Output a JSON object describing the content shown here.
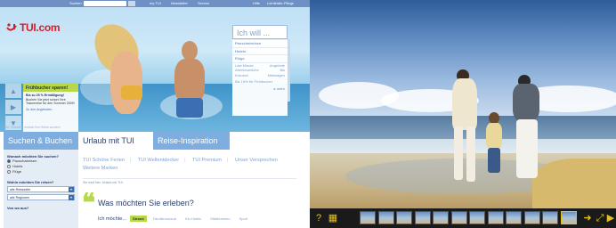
{
  "tui": {
    "topbar": {
      "search_label": "Suchen",
      "links": [
        "my TUI",
        "Newsletter",
        "Service"
      ],
      "user_link": "Hilfe",
      "user_link2": "Leinfelder-Pliege"
    },
    "logo_text": "TUI.com",
    "slide": {
      "headline": "Frühbucher sparen!",
      "discount": "Bis zu 25 % Ermäßigung!",
      "body": "Buchen Sie jetzt schon! Ihre Traumreise für den Sommer 2009!",
      "link": "Zu den Angeboten"
    },
    "hinweis": "Hier: Schnell & einfach Ihre Reise suchen!",
    "ichwill": {
      "title": "Ich will ...",
      "items": [
        "Pauschalreisen",
        "Hotels",
        "Flüge"
      ],
      "pairs": [
        [
          "Last Minute",
          "Angebote"
        ],
        [
          "Abenteuerliche",
          "Bis"
        ],
        [
          "Kreuzen",
          "Mietwagen"
        ]
      ],
      "extra": "Bis 15% für Frühbucher",
      "more": "mehr"
    },
    "tabs": [
      "Suchen & Buchen",
      "Urlaub mit TUI",
      "Reise-Inspiration"
    ],
    "search": {
      "question1": "Wonach möchten Sie suchen?",
      "options": [
        "Pauschalreisen",
        "Hotels",
        "Flüge"
      ],
      "selected_option": "Pauschalreisen",
      "question2": "Wohin möchten Sie reisen?",
      "select1": "alle Reiseziele",
      "select2": "alle Regionen",
      "question3": "Von wo aus?"
    },
    "main": {
      "sublinks": [
        "TUI Schöne Ferien",
        "TUI Weltentdecker",
        "TUI Premium",
        "Unser Versprechen",
        "Weitere Marken"
      ],
      "breadcrumb": "Sie sind hier: Urlaub mit TUI",
      "quote_mark": "❝",
      "heading": "Was möchten Sie erleben?",
      "ich_moechte": "Ich möchte...",
      "chips": [
        "Strand",
        "Familienurlaub",
        "Klu Hotels",
        "Städtereisen",
        "Sport"
      ],
      "active_chip": "Strand"
    }
  },
  "viewer": {
    "controls": {
      "help_icon": "?",
      "grid_icon": "▦",
      "next_icon": "➜",
      "fullscreen_icon": "⤢",
      "play_icon": "▶"
    },
    "thumbnail_count": 12,
    "active_thumbnail": 11
  },
  "colors": {
    "tui_red": "#d21f2a",
    "tui_blue": "#7eaee0",
    "accent_green": "#b8d84a",
    "viewer_yellow": "#e6c020"
  }
}
